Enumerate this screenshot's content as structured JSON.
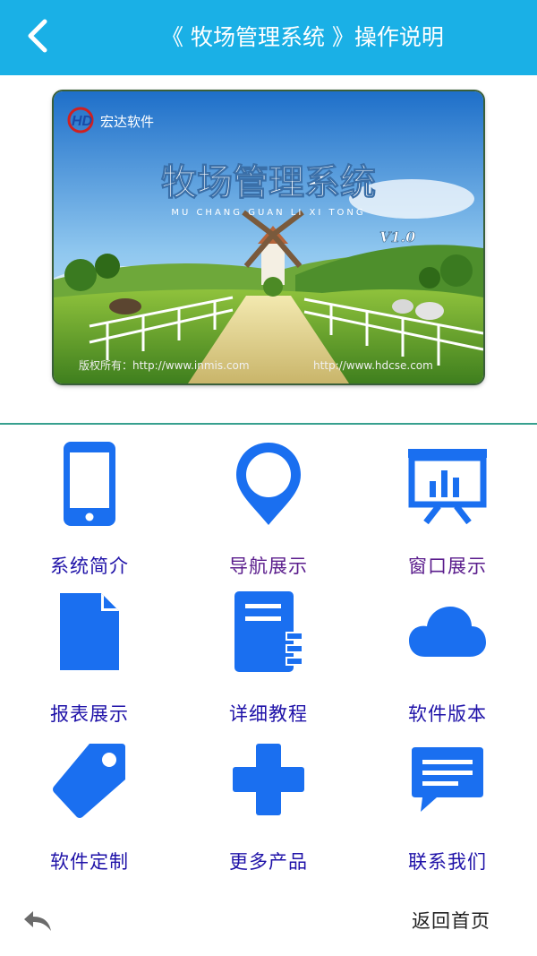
{
  "header": {
    "title": "《 牧场管理系统 》操作说明",
    "back_icon": "chevron-left-icon",
    "background_color": "#1ab0e6"
  },
  "banner": {
    "logo_text": "宏达软件",
    "product_title": "牧场管理系统",
    "product_pinyin": "MU CHANG GUAN LI XI TONG",
    "version": "V1.0",
    "copyright": "版权所有：http://www.inmis.com",
    "website": "http://www.hdcse.com"
  },
  "menu": {
    "items": [
      {
        "label": "系统简介",
        "icon": "smartphone-icon"
      },
      {
        "label": "导航展示",
        "icon": "map-pin-icon"
      },
      {
        "label": "窗口展示",
        "icon": "presentation-chart-icon"
      },
      {
        "label": "报表展示",
        "icon": "document-icon"
      },
      {
        "label": "详细教程",
        "icon": "notebook-icon"
      },
      {
        "label": "软件版本",
        "icon": "cloud-icon"
      },
      {
        "label": "软件定制",
        "icon": "tag-icon"
      },
      {
        "label": "更多产品",
        "icon": "plus-icon"
      },
      {
        "label": "联系我们",
        "icon": "message-icon"
      }
    ],
    "icon_color": "#1a6ff0",
    "label_color": "#1f12a8"
  },
  "footer": {
    "back_icon": "undo-arrow-icon",
    "home_label": "返回首页"
  }
}
